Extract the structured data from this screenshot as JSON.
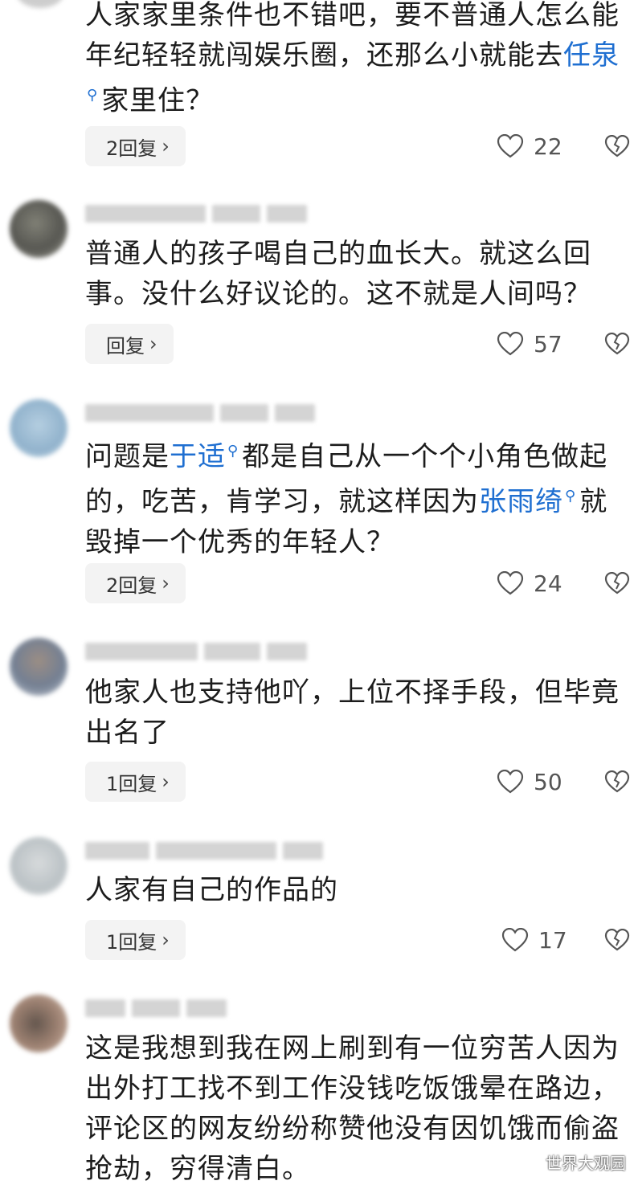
{
  "comments": [
    {
      "text_parts": [
        "人家家里条件也不错吧，要不普通人怎么能年纪轻轻就闯娱乐圈，还那么小就能去",
        "任泉",
        "家里住？"
      ],
      "reply_label": "2回复",
      "likes": "22"
    },
    {
      "text": "普通人的孩子喝自己的血长大。就这么回事。没什么好议论的。这不就是人间吗？",
      "reply_label": "回复",
      "likes": "57"
    },
    {
      "text_parts": [
        "问题是",
        "于适",
        "都是自己从一个个小角色做起的，吃苦，肯学习，就这样因为",
        "张雨绮",
        "就毁掉一个优秀的年轻人？"
      ],
      "reply_label": "2回复",
      "likes": "24"
    },
    {
      "text": "他家人也支持他吖，上位不择手段，但毕竟出名了",
      "reply_label": "1回复",
      "likes": "50"
    },
    {
      "text": "人家有自己的作品的",
      "reply_label": "1回复",
      "likes": "17"
    },
    {
      "text": "这是我想到我在网上刷到有一位穷苦人因为出外打工找不到工作没钱吃饭饿晕在路边，评论区的网友纷纷称赞他没有因饥饿而偷盗抢劫，穷得清白。"
    }
  ],
  "icons": {
    "link_search": "search-icon",
    "like": "heart-icon",
    "dislike": "broken-heart-icon",
    "reply_chevron": "chevron-right-icon"
  },
  "colors": {
    "link": "#1f6fd1",
    "reply_bg": "#f3f3f3"
  },
  "watermark": "世界大观园"
}
